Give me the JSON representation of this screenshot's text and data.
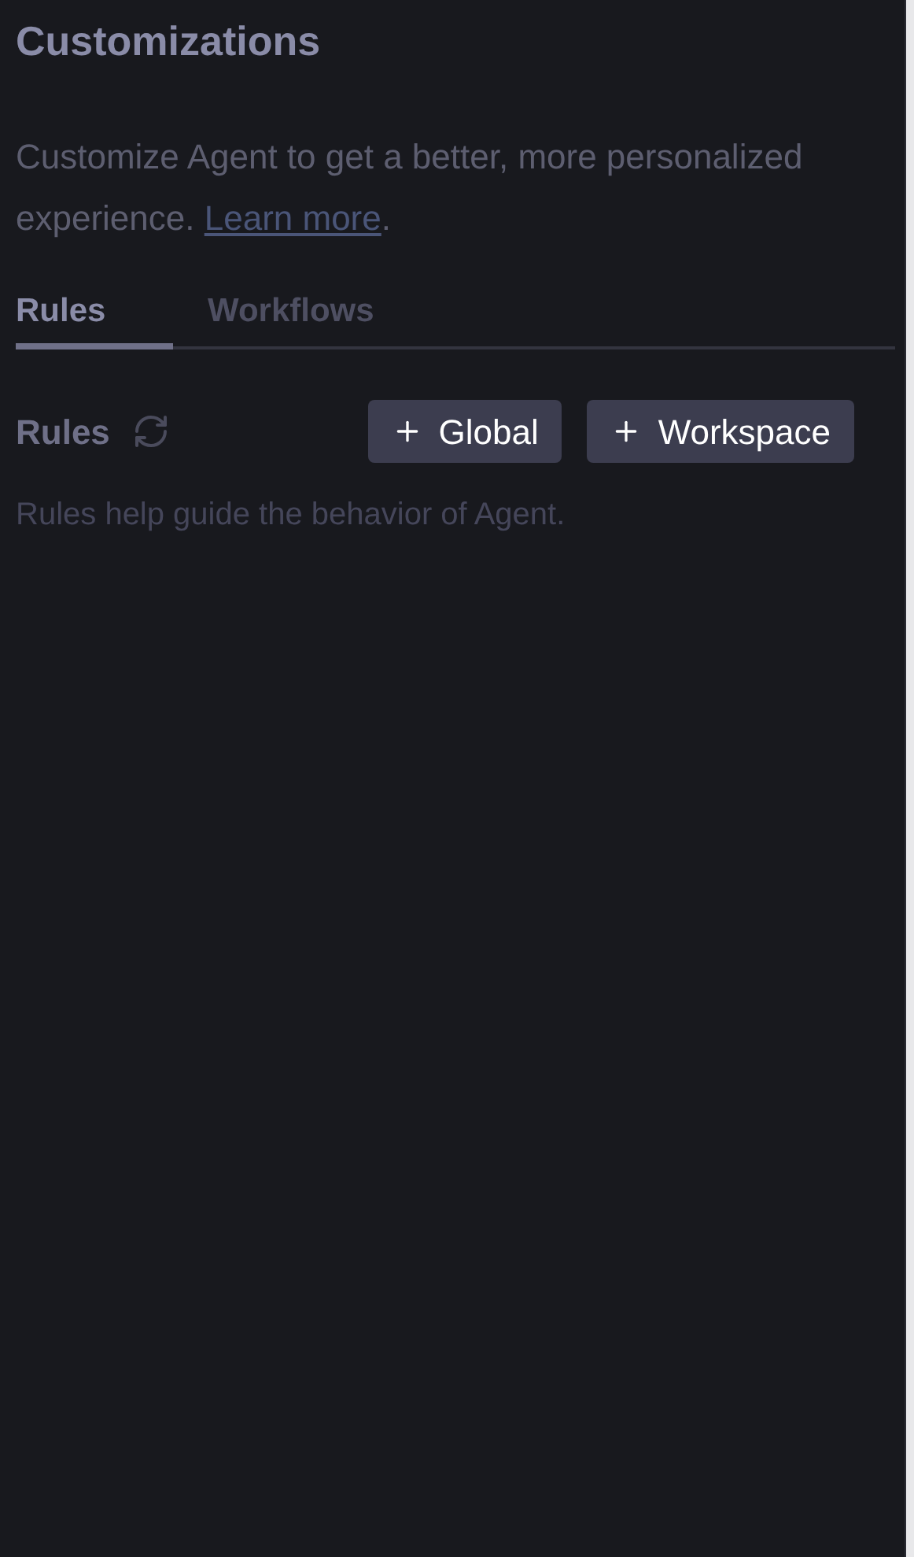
{
  "title": "Customizations",
  "description": {
    "text": "Customize Agent to get a better, more personalized experience. ",
    "link": "Learn more",
    "after": "."
  },
  "tabs": [
    {
      "label": "Rules",
      "selected": true
    },
    {
      "label": "Workflows",
      "selected": false
    }
  ],
  "section": {
    "title": "Rules",
    "buttons": [
      "Global",
      "Workspace"
    ],
    "hint": "Rules help guide the behavior of Agent."
  }
}
